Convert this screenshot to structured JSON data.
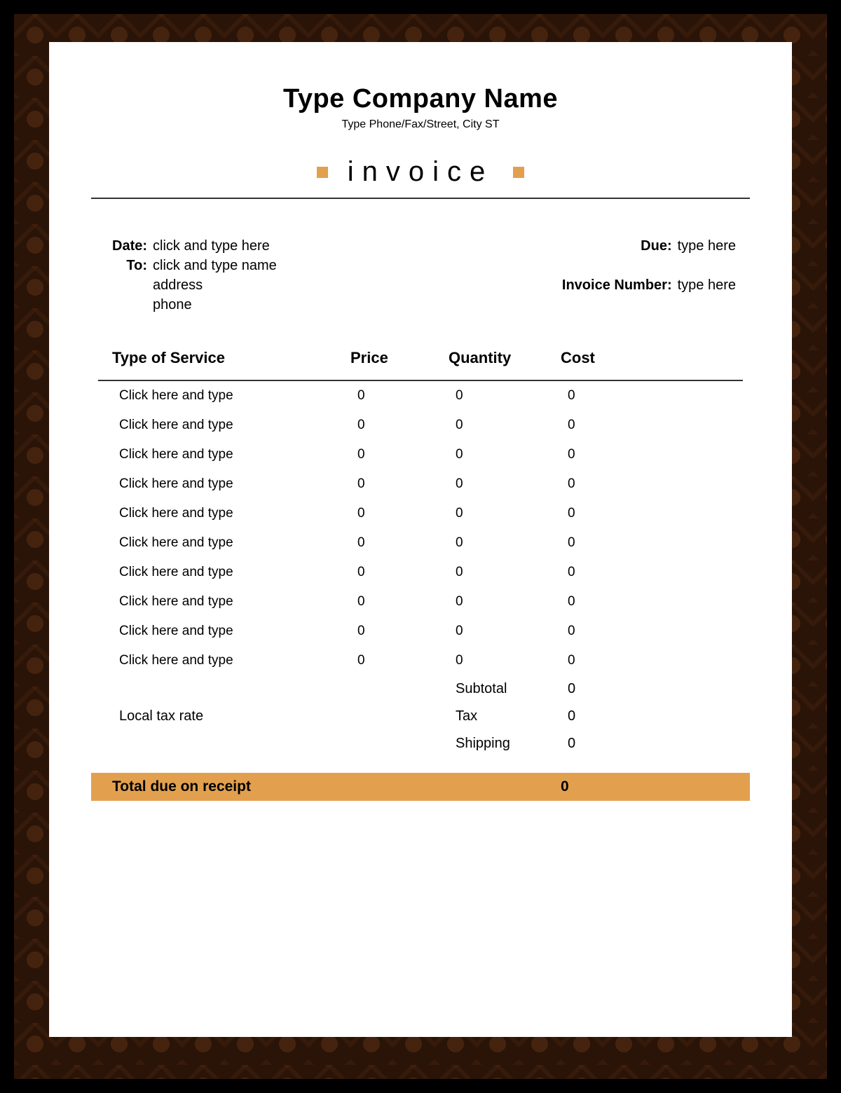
{
  "header": {
    "company_name": "Type Company Name",
    "contact_line": "Type Phone/Fax/Street, City ST",
    "title": "invoice"
  },
  "meta": {
    "date_label": "Date:",
    "date_value": "click and type here",
    "to_label": "To:",
    "to_line1": "click and type name",
    "to_line2": "address",
    "to_line3": "phone",
    "due_label": "Due:",
    "due_value": "type here",
    "invnum_label": "Invoice Number:",
    "invnum_value": "type here"
  },
  "table": {
    "headers": {
      "service": "Type of Service",
      "price": "Price",
      "qty": "Quantity",
      "cost": "Cost"
    },
    "rows": [
      {
        "service": "Click here and type",
        "price": "0",
        "qty": "0",
        "cost": "0"
      },
      {
        "service": "Click here and type",
        "price": "0",
        "qty": "0",
        "cost": "0"
      },
      {
        "service": "Click here and type",
        "price": "0",
        "qty": "0",
        "cost": "0"
      },
      {
        "service": "Click here and type",
        "price": "0",
        "qty": "0",
        "cost": "0"
      },
      {
        "service": "Click here and type",
        "price": "0",
        "qty": "0",
        "cost": "0"
      },
      {
        "service": "Click here and type",
        "price": "0",
        "qty": "0",
        "cost": "0"
      },
      {
        "service": "Click here and type",
        "price": "0",
        "qty": "0",
        "cost": "0"
      },
      {
        "service": "Click here and type",
        "price": "0",
        "qty": "0",
        "cost": "0"
      },
      {
        "service": "Click here and type",
        "price": "0",
        "qty": "0",
        "cost": "0"
      },
      {
        "service": "Click here and type",
        "price": "0",
        "qty": "0",
        "cost": "0"
      }
    ]
  },
  "summary": {
    "tax_rate_label": "Local tax rate",
    "subtotal_label": "Subtotal",
    "subtotal_value": "0",
    "tax_label": "Tax",
    "tax_value": "0",
    "shipping_label": "Shipping",
    "shipping_value": "0",
    "total_label": "Total due on receipt",
    "total_value": "0"
  },
  "colors": {
    "accent": "#e2a04f",
    "frame": "#2a1408"
  }
}
